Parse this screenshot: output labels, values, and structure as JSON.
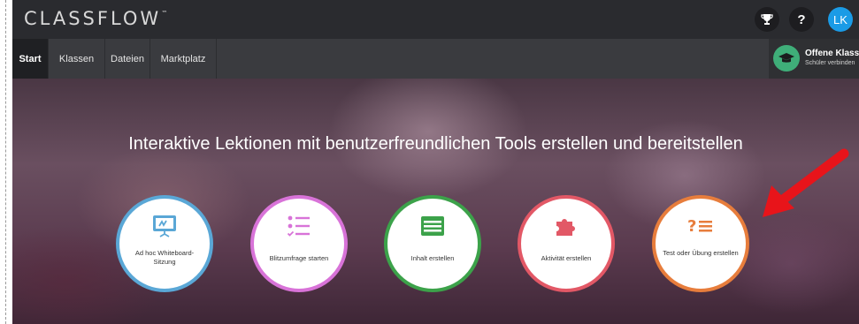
{
  "app": {
    "logo": "CLASSFLOW",
    "trademark": "™"
  },
  "header": {
    "trophy_icon": "trophy-icon",
    "help_label": "?",
    "avatar_initials": "LK"
  },
  "nav": {
    "tabs": [
      {
        "label": "Start",
        "active": true
      },
      {
        "label": "Klassen",
        "active": false
      },
      {
        "label": "Dateien",
        "active": false
      },
      {
        "label": "Marktplatz",
        "active": false
      }
    ]
  },
  "class_panel": {
    "title": "Offene Klasse",
    "subtitle": "Schüler verbinden",
    "icon": "graduation-cap-icon"
  },
  "hero": {
    "headline": "Interaktive Lektionen mit benutzerfreundlichen Tools erstellen und bereitstellen"
  },
  "actions": [
    {
      "label": "Ad hoc Whiteboard-Sitzung",
      "icon": "whiteboard-icon",
      "color": "#5aa7d6"
    },
    {
      "label": "Blitzumfrage starten",
      "icon": "checklist-icon",
      "color": "#d873d8"
    },
    {
      "label": "Inhalt erstellen",
      "icon": "content-icon",
      "color": "#3ca24a"
    },
    {
      "label": "Aktivität erstellen",
      "icon": "puzzle-icon",
      "color": "#e25866"
    },
    {
      "label": "Test oder Übung erstellen",
      "icon": "quiz-icon",
      "color": "#e77d3c"
    }
  ],
  "annotation": {
    "arrow_color": "#e8141a",
    "icon": "red-arrow-icon"
  },
  "colors": {
    "topbar": "#2a2b2f",
    "navbar": "#3a3b3f",
    "avatar": "#1a9be6",
    "class_icon": "#3fae79"
  }
}
